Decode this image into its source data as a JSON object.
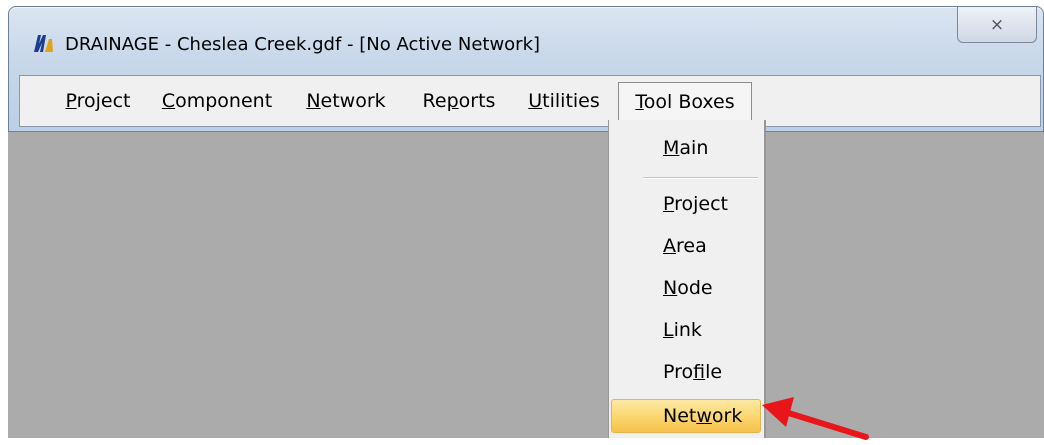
{
  "window": {
    "title": "DRAINAGE - Cheslea Creek.gdf - [No Active Network]",
    "icon": "drainage-app-icon",
    "close_glyph": "⨯"
  },
  "menubar": {
    "items": [
      {
        "pre": "",
        "u": "P",
        "post": "roject"
      },
      {
        "pre": "",
        "u": "C",
        "post": "omponent"
      },
      {
        "pre": "",
        "u": "N",
        "post": "etwork"
      },
      {
        "pre": "Re",
        "u": "p",
        "post": "orts"
      },
      {
        "pre": "",
        "u": "U",
        "post": "tilities"
      },
      {
        "pre": "",
        "u": "T",
        "post": "ool Boxes"
      }
    ]
  },
  "dropdown": {
    "items": [
      {
        "pre": "",
        "u": "M",
        "post": "ain"
      },
      {
        "pre": "",
        "u": "P",
        "post": "roject"
      },
      {
        "pre": "",
        "u": "A",
        "post": "rea"
      },
      {
        "pre": "",
        "u": "N",
        "post": "ode"
      },
      {
        "pre": "",
        "u": "L",
        "post": "ink"
      },
      {
        "pre": "Pro",
        "u": "f",
        "post": "ile"
      },
      {
        "pre": "Net",
        "u": "w",
        "post": "ork"
      }
    ],
    "highlighted_index": 6
  },
  "colors": {
    "highlight": "#fbd56c",
    "arrow": "#e8161b",
    "workspace": "#ababab"
  }
}
